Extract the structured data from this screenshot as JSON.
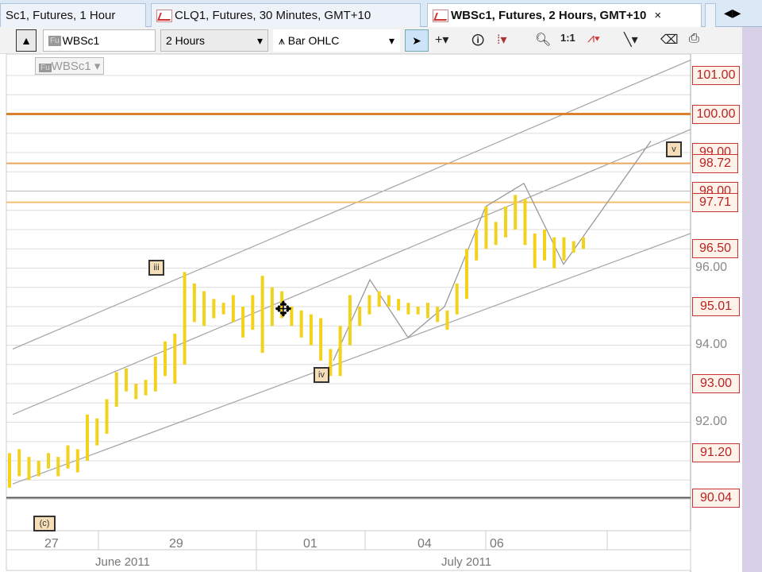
{
  "tabs": [
    {
      "label": "Sc1, Futures, 1 Hour"
    },
    {
      "label": "CLQ1, Futures, 30 Minutes, GMT+10"
    },
    {
      "label": "WBSc1, Futures, 2 Hours, GMT+10",
      "active": true,
      "close": "×"
    }
  ],
  "toolbar": {
    "symbol": "WBSc1",
    "symbol_badge": "Fu",
    "interval": "2 Hours",
    "chart_type": "Bar OHLC",
    "dropdown": "▾"
  },
  "legend": {
    "badge": "Fu",
    "symbol": "WBSc1 ▾"
  },
  "chart_data": {
    "type": "ohlc",
    "price_labels_highlighted": [
      "101.00",
      "100.00",
      "99.00",
      "98.72",
      "98.00",
      "97.71",
      "96.50",
      "95.01",
      "93.00",
      "91.20",
      "90.04"
    ],
    "price_labels": [
      "96.00",
      "94.00",
      "92.00"
    ],
    "date_ticks": [
      "27",
      "29",
      "01",
      "04",
      "06"
    ],
    "months": [
      "June 2011",
      "July 2011"
    ],
    "waves": {
      "iii": "iii",
      "iv": "iv",
      "v": "v",
      "c": "(c)"
    },
    "ylim": [
      89.2,
      101.6
    ],
    "bars": [
      [
        91.2,
        90.3
      ],
      [
        91.3,
        90.6
      ],
      [
        91.1,
        90.5
      ],
      [
        91.0,
        90.6
      ],
      [
        91.2,
        90.8
      ],
      [
        91.1,
        90.6
      ],
      [
        91.4,
        90.8
      ],
      [
        91.3,
        90.7
      ],
      [
        92.2,
        91.0
      ],
      [
        92.1,
        91.4
      ],
      [
        92.6,
        91.7
      ],
      [
        93.3,
        92.4
      ],
      [
        93.4,
        92.8
      ],
      [
        93.0,
        92.6
      ],
      [
        93.1,
        92.7
      ],
      [
        93.7,
        92.8
      ],
      [
        94.1,
        93.2
      ],
      [
        94.3,
        93.0
      ],
      [
        95.9,
        93.5
      ],
      [
        95.6,
        94.6
      ],
      [
        95.4,
        94.5
      ],
      [
        95.2,
        94.7
      ],
      [
        95.1,
        94.8
      ],
      [
        95.3,
        94.6
      ],
      [
        95.0,
        94.2
      ],
      [
        95.3,
        94.4
      ],
      [
        95.8,
        93.8
      ],
      [
        95.5,
        94.5
      ],
      [
        95.4,
        94.7
      ],
      [
        95.0,
        94.5
      ],
      [
        94.9,
        94.2
      ],
      [
        94.8,
        94.0
      ],
      [
        94.7,
        93.6
      ],
      [
        93.9,
        93.2
      ],
      [
        94.5,
        93.2
      ],
      [
        95.3,
        94.0
      ],
      [
        95.0,
        94.5
      ],
      [
        95.3,
        94.8
      ],
      [
        95.4,
        95.0
      ],
      [
        95.3,
        95.0
      ],
      [
        95.2,
        94.9
      ],
      [
        95.1,
        94.8
      ],
      [
        95.0,
        94.8
      ],
      [
        95.1,
        94.7
      ],
      [
        95.0,
        94.6
      ],
      [
        94.9,
        94.4
      ],
      [
        95.6,
        94.8
      ],
      [
        96.5,
        95.2
      ],
      [
        97.0,
        96.2
      ],
      [
        97.6,
        96.5
      ],
      [
        97.2,
        96.6
      ],
      [
        97.6,
        96.8
      ],
      [
        97.9,
        97.0
      ],
      [
        97.8,
        96.6
      ],
      [
        96.9,
        96.0
      ],
      [
        97.0,
        96.2
      ],
      [
        96.8,
        96.0
      ],
      [
        96.8,
        96.2
      ],
      [
        96.7,
        96.4
      ],
      [
        96.8,
        96.5
      ]
    ]
  }
}
